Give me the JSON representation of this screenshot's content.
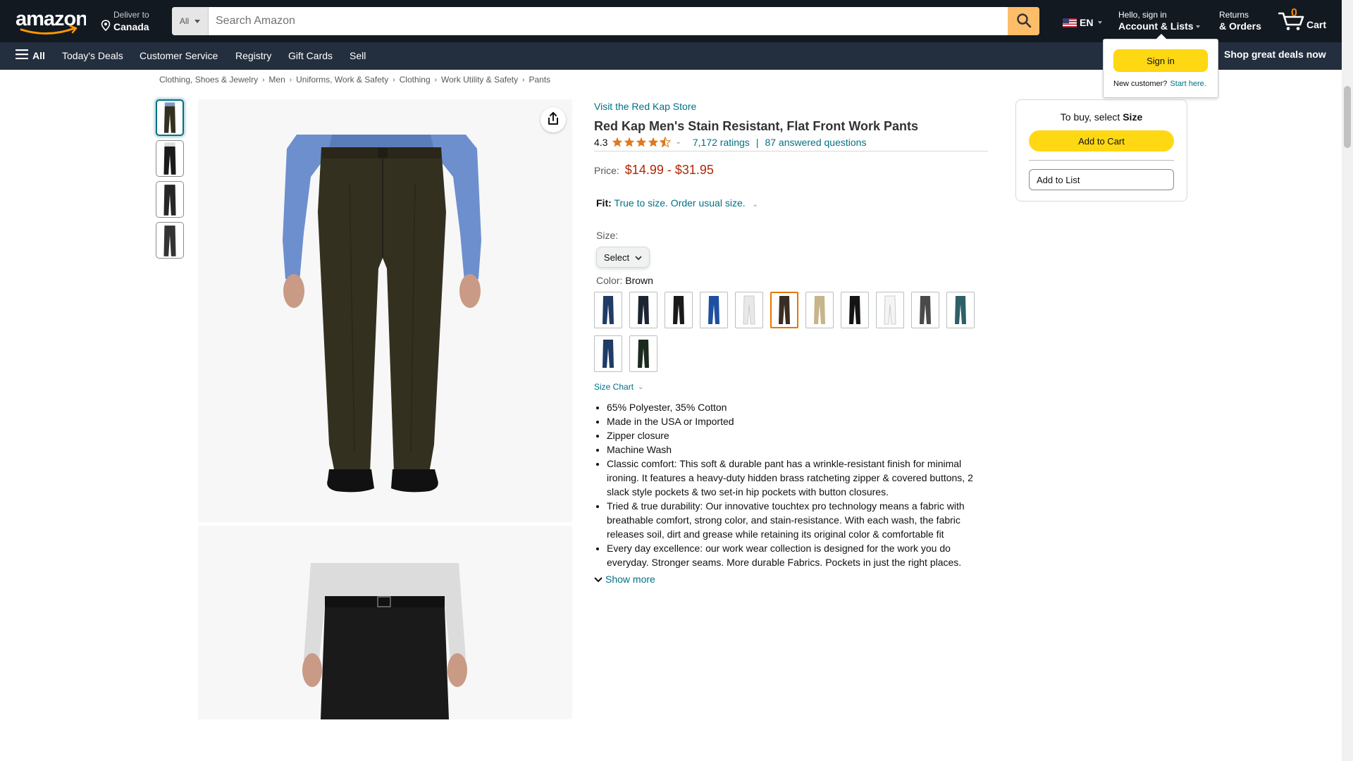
{
  "header": {
    "deliver_line1": "Deliver to",
    "deliver_line2": "Canada",
    "search_dept": "All",
    "search_placeholder": "Search Amazon",
    "language": "EN",
    "account_line1": "Hello, sign in",
    "account_line2": "Account & Lists",
    "returns_line1": "Returns",
    "returns_line2": "& Orders",
    "cart_count": "0",
    "cart_label": "Cart"
  },
  "subnav": {
    "all_label": "All",
    "links": [
      "Today's Deals",
      "Customer Service",
      "Registry",
      "Gift Cards",
      "Sell"
    ],
    "promo": "Shop great deals now"
  },
  "signin_flyout": {
    "button": "Sign in",
    "new_customer": "New customer?",
    "start_here": "Start here."
  },
  "breadcrumb": [
    "Clothing, Shoes & Jewelry",
    "Men",
    "Uniforms, Work & Safety",
    "Clothing",
    "Work Utility & Safety",
    "Pants"
  ],
  "product": {
    "store_link": "Visit the Red Kap Store",
    "title": "Red Kap Men's Stain Resistant, Flat Front Work Pants",
    "rating": "4.3",
    "stars_value": 4.3,
    "ratings_count": "7,172 ratings",
    "answered_questions": "87 answered questions",
    "price_label": "Price:",
    "price_low": "$14.99",
    "price_dash": "-",
    "price_high": "$31.95",
    "fit_label": "Fit:",
    "fit_text": "True to size. Order usual size.",
    "size_label": "Size:",
    "size_select": "Select",
    "color_label": "Color:",
    "color_value": "Brown",
    "size_chart": "Size Chart",
    "bullets": [
      "65% Polyester, 35% Cotton",
      "Made in the USA or Imported",
      "Zipper closure",
      "Machine Wash",
      "Classic comfort: This soft & durable pant has a wrinkle-resistant finish for minimal ironing. It features a heavy-duty hidden brass ratcheting zipper & covered buttons, 2 slack style pockets & two set-in hip pockets with button closures.",
      "Tried & true durability: Our innovative touchtex pro technology means a fabric with breathable comfort, strong color, and stain-resistance. With each wash, the fabric releases soil, dirt and grease while retaining its original color & comfortable fit",
      "Every day excellence: our work wear collection is designed for the work you do everyday. Stronger seams. More durable Fabrics. Pockets in just the right places."
    ],
    "show_more": "Show more"
  },
  "swatch_colors": [
    "#1f3b66",
    "#1c2433",
    "#1a1a1a",
    "#1f4fa0",
    "#e8e8e8",
    "#3a2e22",
    "#c8b48a",
    "#141414",
    "#f4f4f4",
    "#4a4a4a",
    "#2e5f66",
    "#1f3b66",
    "#1b2a1d"
  ],
  "selected_swatch_index": 5,
  "buybox": {
    "to_buy": "To buy, select ",
    "to_buy_bold": "Size",
    "add_to_cart": "Add to Cart",
    "add_to_list": "Add to List"
  },
  "colors": {
    "nav_dark": "#131921",
    "nav_secondary": "#232f3e",
    "accent_yellow": "#ffd814",
    "price_red": "#b12704",
    "link_teal": "#007185",
    "star_orange": "#de7921"
  }
}
